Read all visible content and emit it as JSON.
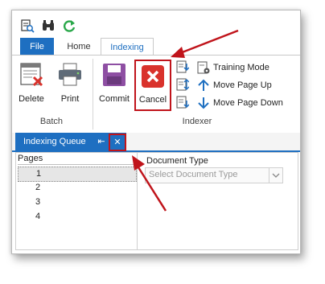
{
  "quick_access": {
    "icons": [
      "search-doc-icon",
      "binoculars-icon",
      "refresh-icon"
    ]
  },
  "tabs": [
    {
      "label": "File",
      "active": false
    },
    {
      "label": "Home",
      "active": false
    },
    {
      "label": "Indexing",
      "active": true
    }
  ],
  "ribbon": {
    "batch": {
      "group_label": "Batch",
      "buttons": [
        {
          "label": "Delete"
        },
        {
          "label": "Print"
        }
      ]
    },
    "indexer": {
      "group_label": "Indexer",
      "commit_label": "Commit",
      "cancel_label": "Cancel",
      "small_buttons": [
        {
          "label": "Training Mode"
        },
        {
          "label": "Move Page Up"
        },
        {
          "label": "Move Page Down"
        }
      ]
    }
  },
  "queue_panel": {
    "title": "Indexing Queue",
    "pin_glyph": "⇤",
    "close_glyph": "✕"
  },
  "pages": {
    "header": "Pages",
    "items": [
      "1",
      "2",
      "3",
      "4"
    ]
  },
  "document_type": {
    "label": "Document Type",
    "placeholder": "Select Document Type"
  },
  "colors": {
    "accent": "#1e6fc1",
    "highlight_box": "#c0141b",
    "cancel_red": "#d9322c"
  }
}
